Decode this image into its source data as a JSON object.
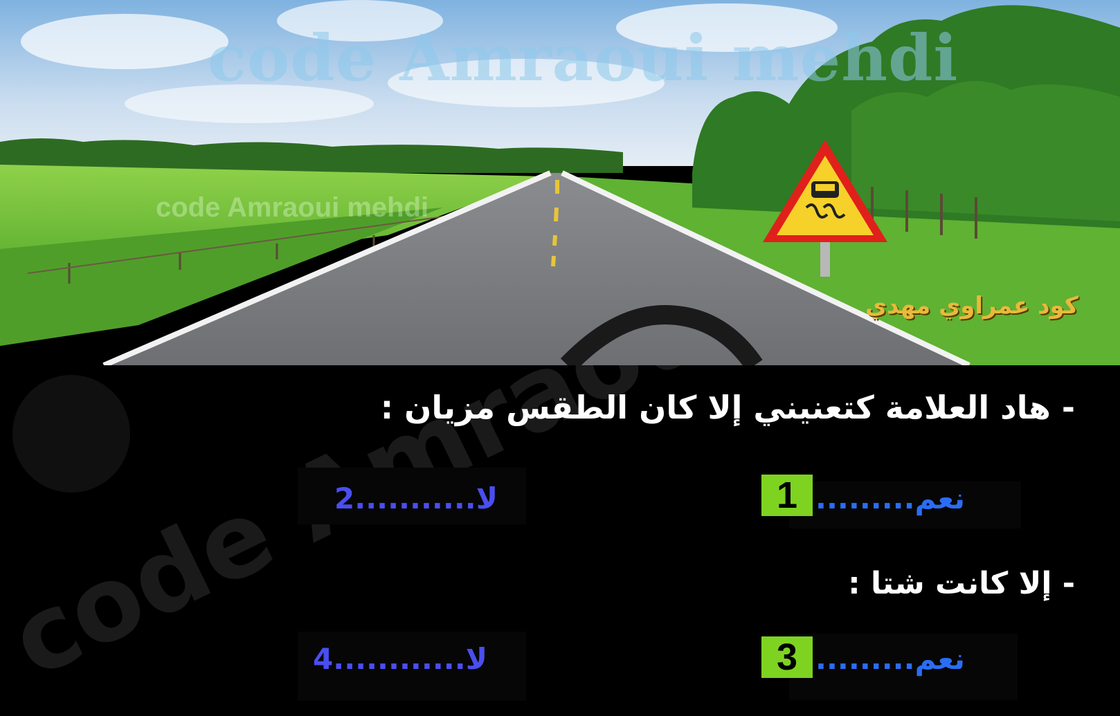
{
  "watermark": {
    "top": "code Amraoui mehdi",
    "middle": "code Amraoui mehdi",
    "arabic": "كود عمراوي مهدي",
    "diagonal": "code Amraoui mehdi"
  },
  "questions": [
    {
      "text": "- هاد العلامة كتعنيني إلا كان الطقس مزيان :",
      "options": [
        {
          "label": "نعم",
          "dots": ".........",
          "number": "1",
          "selected": true
        },
        {
          "label": "لا",
          "dots": "...........",
          "number": "2",
          "selected": false
        }
      ]
    },
    {
      "text": "- إلا كانت شتا :",
      "options": [
        {
          "label": "نعم",
          "dots": ".........",
          "number": "3",
          "selected": true
        },
        {
          "label": "لا",
          "dots": "............",
          "number": "4",
          "selected": false
        }
      ]
    }
  ],
  "colors": {
    "selected_badge": "#7ed321",
    "option_text_selected": "#2a6df5",
    "option_text_unselected": "#4a4ef0",
    "warning_sign_border": "#e0201b",
    "warning_sign_fill": "#f6d12a"
  },
  "icons": {
    "road_sign": "slippery-road-warning-icon",
    "steering_wheel": "steering-wheel-icon"
  }
}
